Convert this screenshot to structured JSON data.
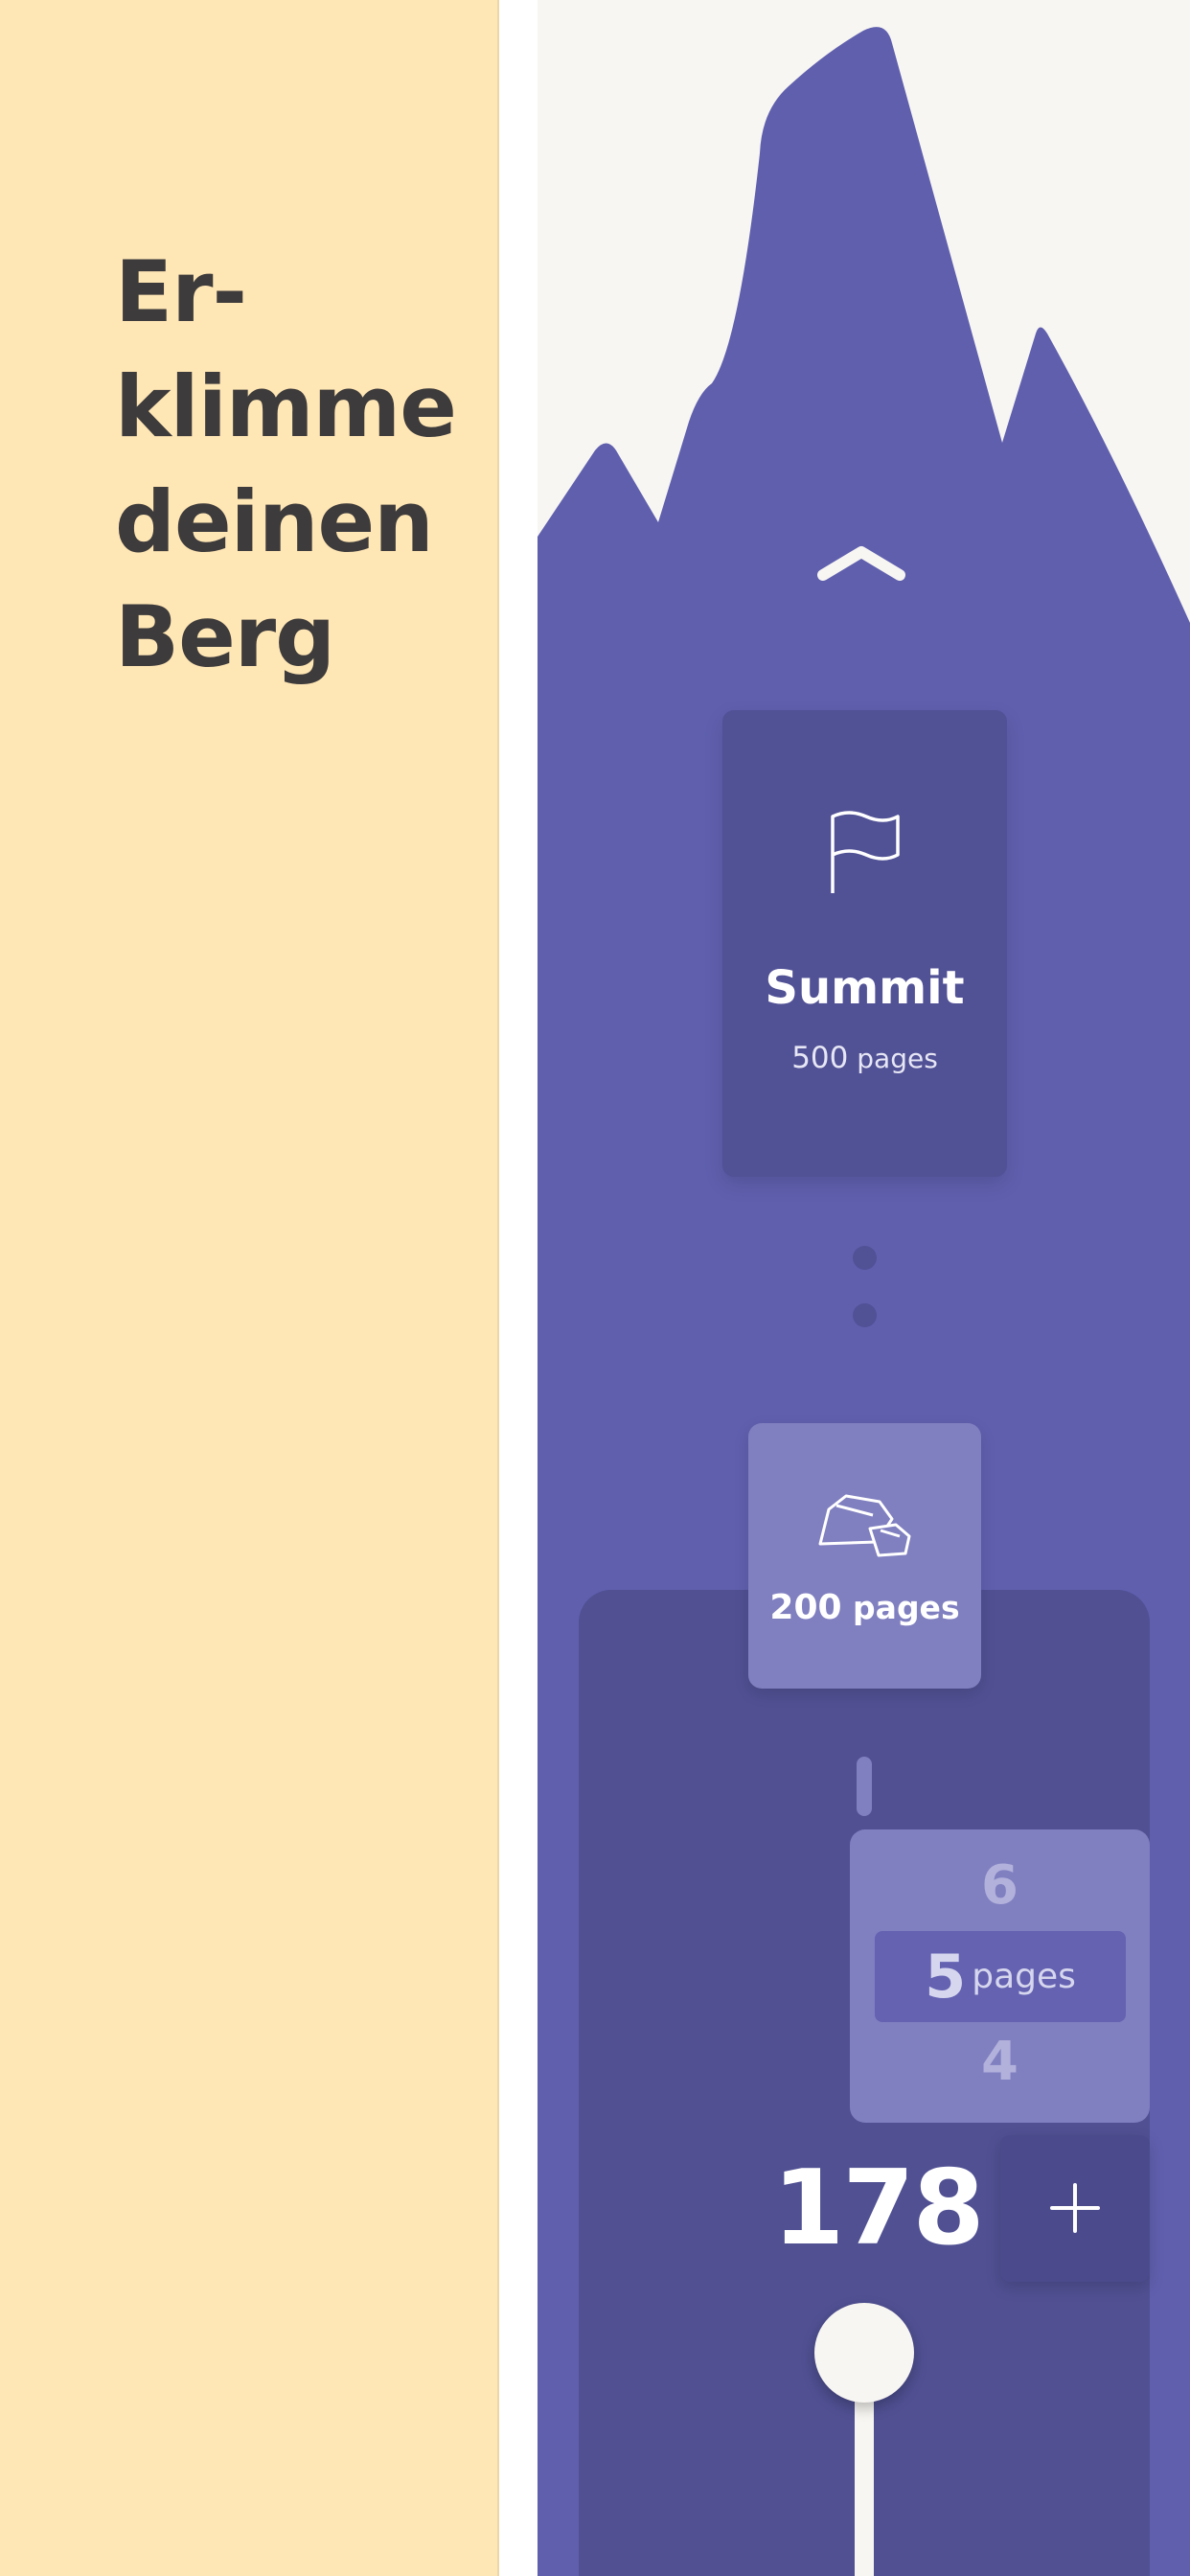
{
  "promo": {
    "headline_lines": [
      "Er-",
      "klimme",
      "deinen",
      "Berg"
    ],
    "background_color": "#ffe6b5",
    "text_color": "#3d3b3b"
  },
  "app": {
    "colors": {
      "sky": "#f8f6f2",
      "mountain": "#5f5fae",
      "card_dark": "#515196",
      "card_light": "#807fc0",
      "panel": "#505093"
    },
    "scroll_up_icon": "chevron-up-icon",
    "summit": {
      "icon": "flag-icon",
      "title": "Summit",
      "pages_number": "500",
      "pages_unit": "pages"
    },
    "milestone": {
      "icon": "rock-icon",
      "pages_number": "200",
      "pages_unit": "pages"
    },
    "page_picker": {
      "above": "6",
      "selected": "5",
      "selected_unit": "pages",
      "below": "4"
    },
    "counter": "178",
    "add_icon": "plus-icon"
  }
}
